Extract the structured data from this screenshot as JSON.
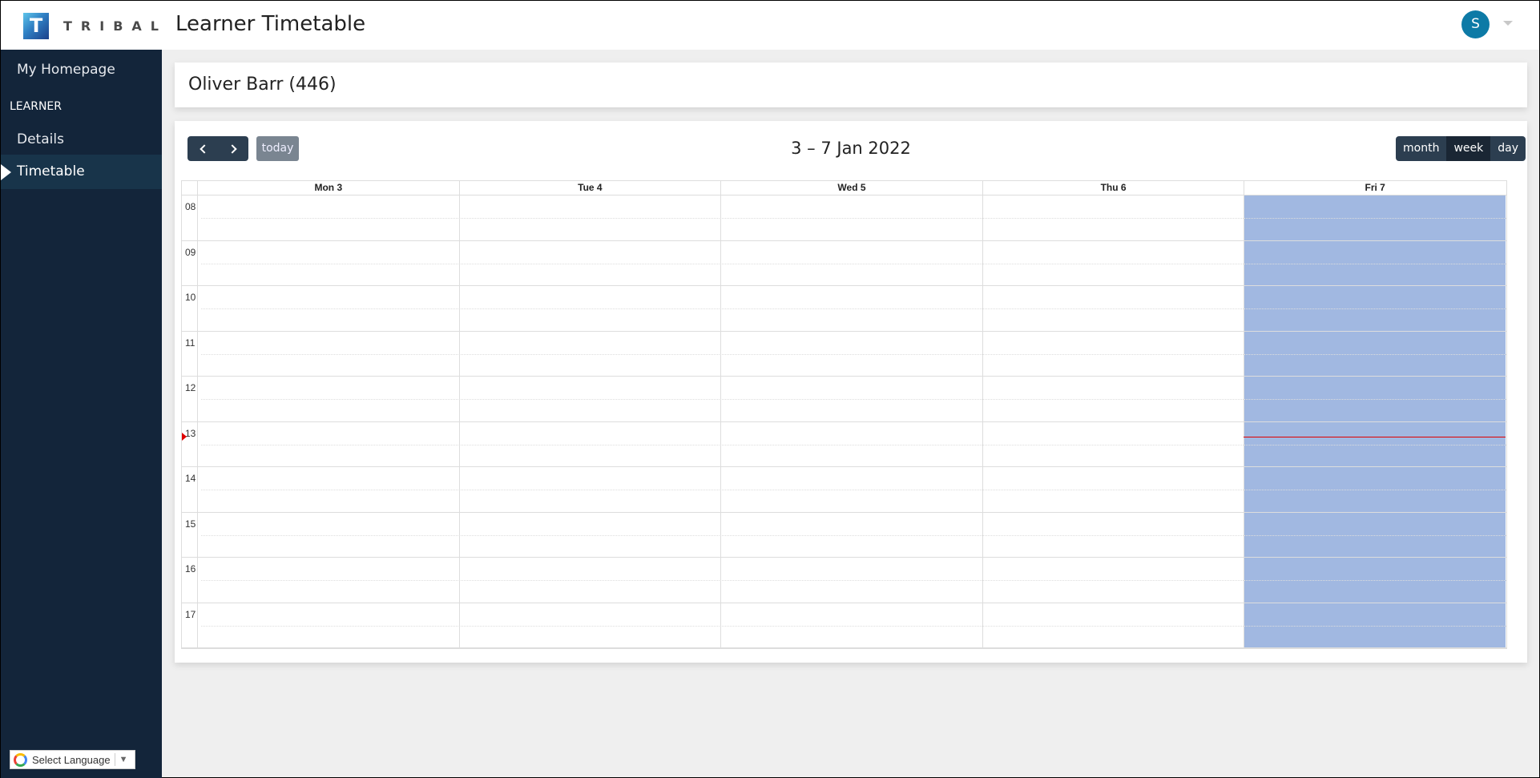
{
  "header": {
    "logo_letter": "T",
    "logo_text": "TRIBAL",
    "app_title": "Learner Timetable",
    "user_initial": "S"
  },
  "sidebar": {
    "homepage_label": "My Homepage",
    "section_label": "LEARNER",
    "items": [
      {
        "label": "Details",
        "active": false
      },
      {
        "label": "Timetable",
        "active": true
      }
    ],
    "language_label": "Select Language",
    "language_caret": "▼"
  },
  "learner": {
    "name": "Oliver Barr (446)"
  },
  "calendar": {
    "today_label": "today",
    "range_title": "3 – 7 Jan 2022",
    "views": [
      {
        "label": "month",
        "active": false
      },
      {
        "label": "week",
        "active": true
      },
      {
        "label": "day",
        "active": false
      }
    ],
    "days": [
      {
        "label": "Mon 3",
        "today": false
      },
      {
        "label": "Tue 4",
        "today": false
      },
      {
        "label": "Wed 5",
        "today": false
      },
      {
        "label": "Thu 6",
        "today": false
      },
      {
        "label": "Fri 7",
        "today": true
      }
    ],
    "hours": [
      "08",
      "09",
      "10",
      "11",
      "12",
      "13",
      "14",
      "15",
      "16",
      "17"
    ],
    "now_time": "13:20",
    "colors": {
      "today_bg": "#a1b8e1",
      "now_indicator": "#e00000",
      "toolbar_button": "#2c3e50",
      "sidebar_bg": "#13253a",
      "avatar": "#0d7aa6"
    }
  }
}
